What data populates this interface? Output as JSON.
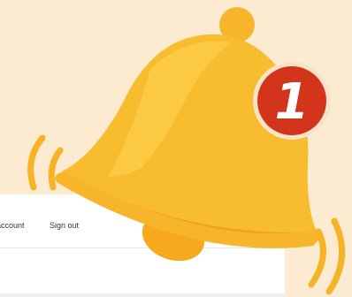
{
  "header": {
    "account_label": "account",
    "signout_label": "Sign out"
  },
  "notification": {
    "icon": "bell-icon",
    "count": "1",
    "badge_color": "#d2351b",
    "bell_color": "#f7b52c"
  }
}
